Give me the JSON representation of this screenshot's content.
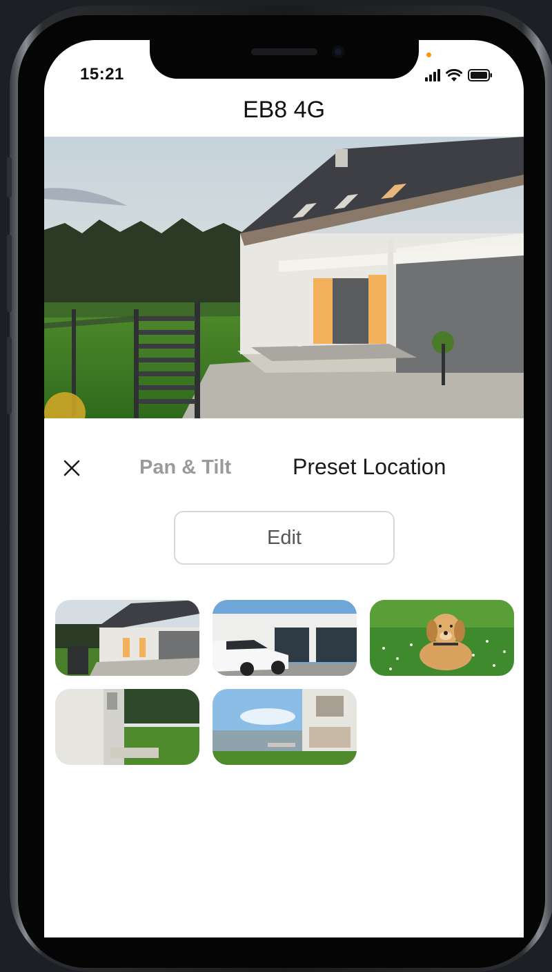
{
  "status_bar": {
    "time": "15:21"
  },
  "header": {
    "title": "EB8 4G"
  },
  "live_view": {
    "description_icon": "camera-live-view"
  },
  "controls": {
    "close_icon": "close-icon",
    "tabs": [
      {
        "label": "Pan & Tilt",
        "active": false
      },
      {
        "label": "Preset Location",
        "active": true
      }
    ],
    "edit_label": "Edit"
  },
  "presets": [
    {
      "name": "preset-house-front"
    },
    {
      "name": "preset-car-garage"
    },
    {
      "name": "preset-dog-lawn"
    },
    {
      "name": "preset-side-yard"
    },
    {
      "name": "preset-pool"
    }
  ],
  "colors": {
    "accent_dot": "#ff9500",
    "inactive_tab": "#9a9a9a",
    "active_tab": "#1a1a1a"
  }
}
